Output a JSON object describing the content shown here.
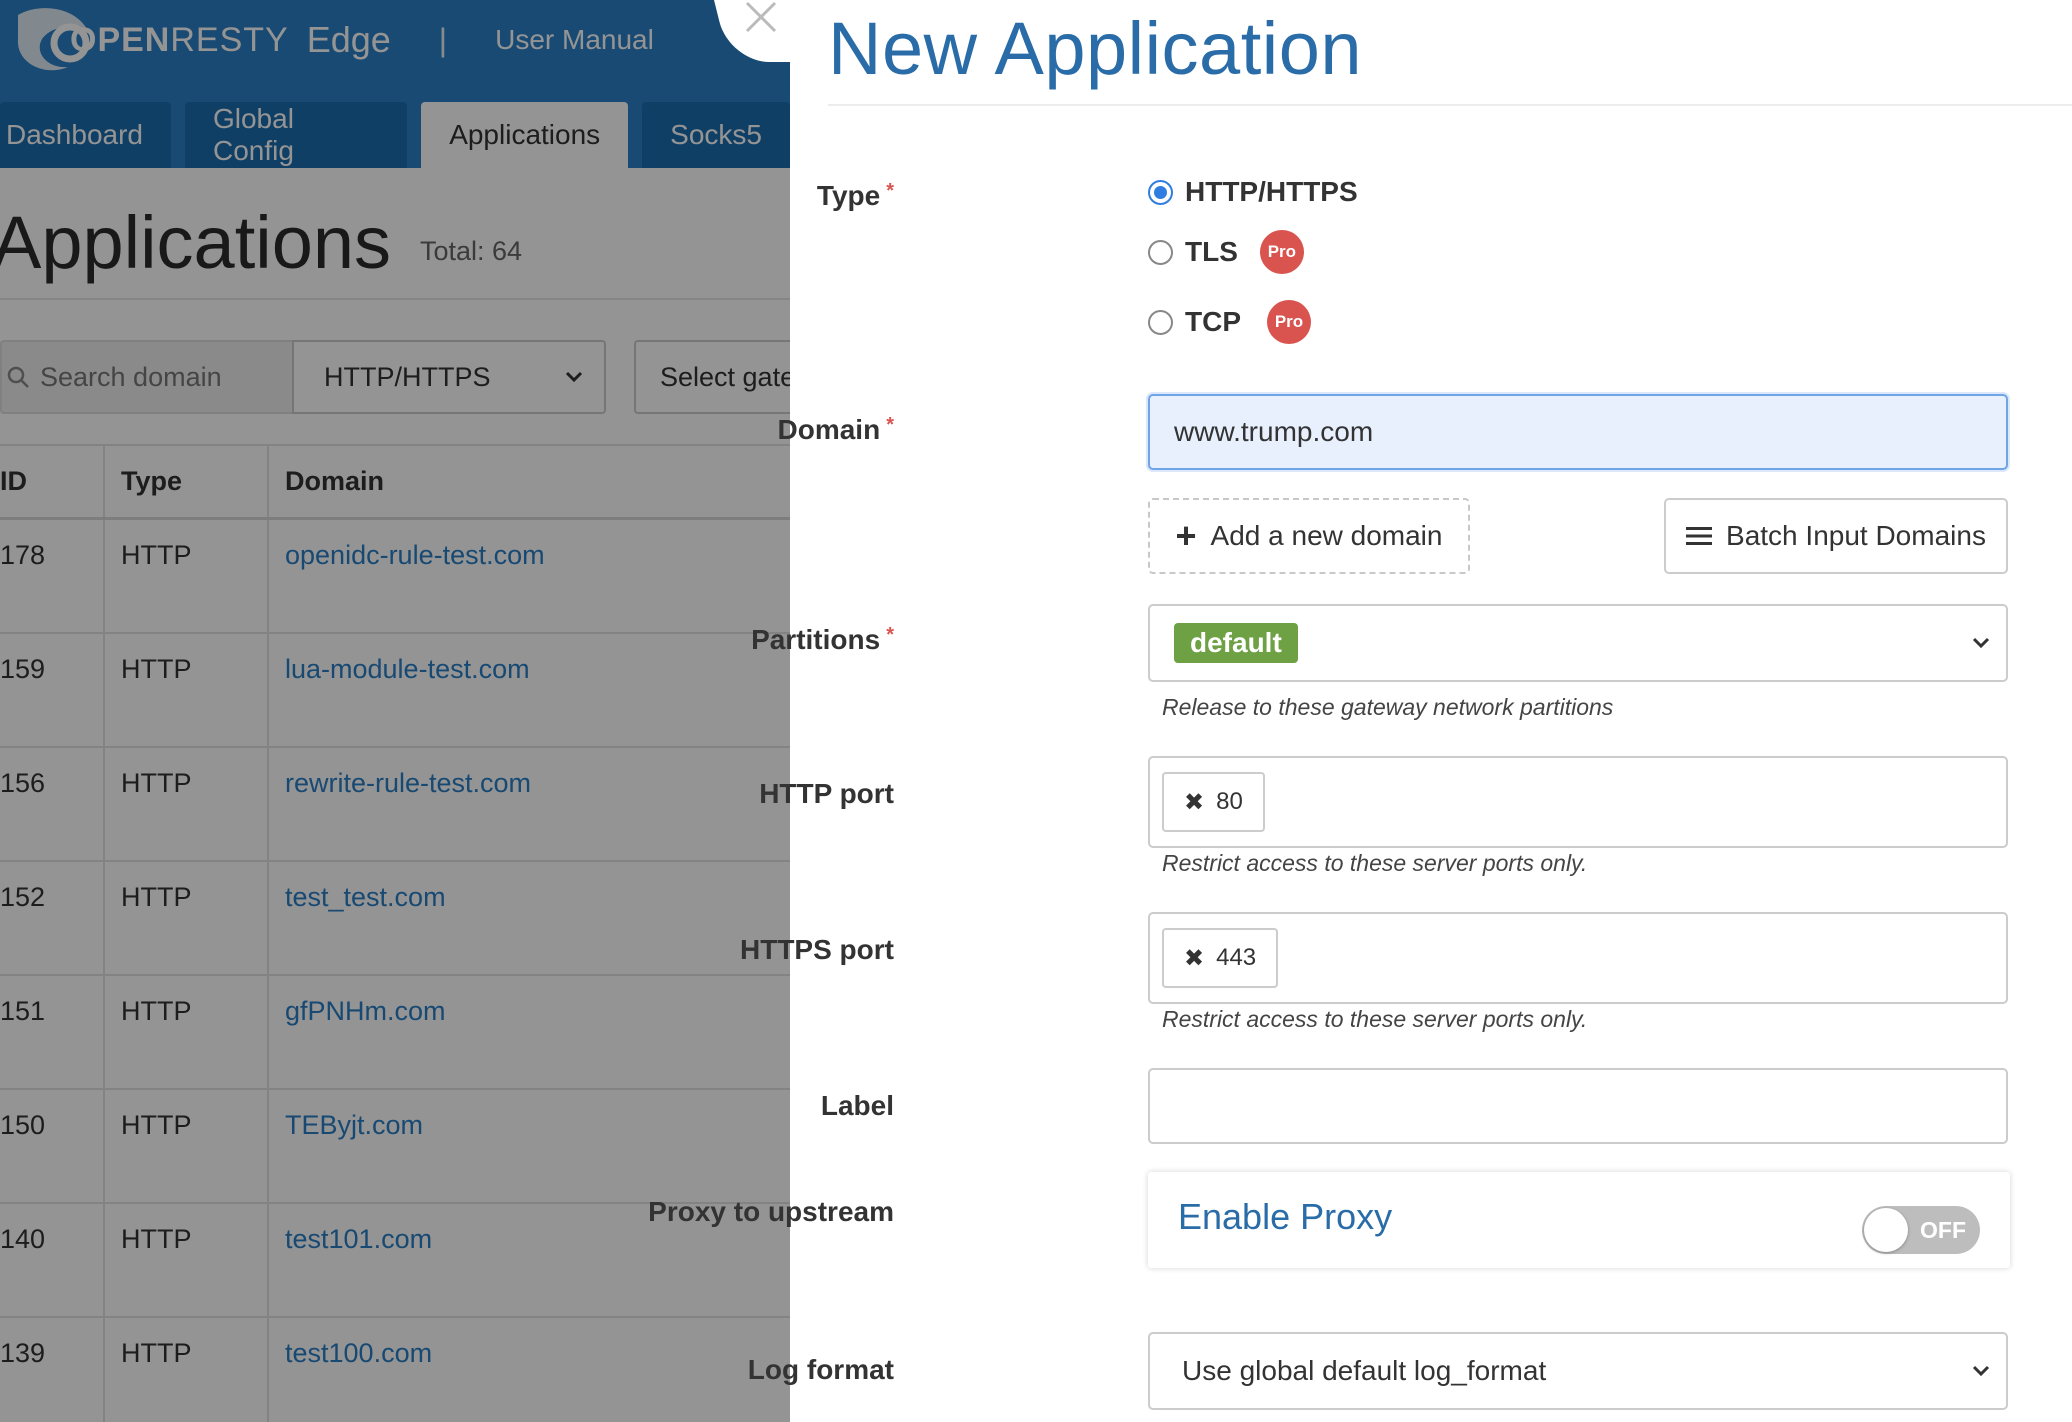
{
  "app": {
    "brand_name_bold": "OPEN",
    "brand_name_light": "RESTY",
    "brand_edge": "Edge",
    "brand_sep": "|",
    "user_manual": "User Manual"
  },
  "nav": {
    "tabs": [
      {
        "label": "Dashboard",
        "active": false
      },
      {
        "label": "Global Config",
        "active": false
      },
      {
        "label": "Applications",
        "active": true
      },
      {
        "label": "Socks5",
        "active": false
      }
    ]
  },
  "list_page": {
    "title": "Applications",
    "total": "Total: 64",
    "search_placeholder": "Search domain",
    "type_filter": "HTTP/HTTPS",
    "gateway_filter": "Select gateway",
    "columns": [
      "ID",
      "Type",
      "Domain"
    ],
    "rows": [
      {
        "id": "178",
        "type": "HTTP",
        "domain": "openidc-rule-test.com"
      },
      {
        "id": "159",
        "type": "HTTP",
        "domain": "lua-module-test.com"
      },
      {
        "id": "156",
        "type": "HTTP",
        "domain": "rewrite-rule-test.com"
      },
      {
        "id": "152",
        "type": "HTTP",
        "domain": "test_test.com"
      },
      {
        "id": "151",
        "type": "HTTP",
        "domain": "gfPNHm.com"
      },
      {
        "id": "150",
        "type": "HTTP",
        "domain": "TEByjt.com"
      },
      {
        "id": "140",
        "type": "HTTP",
        "domain": "test101.com"
      },
      {
        "id": "139",
        "type": "HTTP",
        "domain": "test100.com"
      }
    ]
  },
  "drawer": {
    "title": "New Application",
    "type_label": "Type",
    "type_options": [
      {
        "label": "HTTP/HTTPS",
        "selected": true,
        "pro": false
      },
      {
        "label": "TLS",
        "selected": false,
        "pro": true
      },
      {
        "label": "TCP",
        "selected": false,
        "pro": true
      }
    ],
    "pro_badge": "Pro",
    "domain_label": "Domain",
    "domain_value": "www.trump.com",
    "add_domain_button": "Add a new domain",
    "batch_input_button": "Batch Input Domains",
    "partitions_label": "Partitions",
    "partition_tag": "default",
    "partitions_help": "Release to these gateway network partitions",
    "http_port_label": "HTTP port",
    "http_port_value": "80",
    "http_port_help": "Restrict access to these server ports only.",
    "https_port_label": "HTTPS port",
    "https_port_value": "443",
    "https_port_help": "Restrict access to these server ports only.",
    "label_label": "Label",
    "label_value": "",
    "proxy_label": "Proxy to upstream",
    "proxy_text": "Enable Proxy",
    "proxy_toggle": "OFF",
    "log_format_label": "Log format",
    "log_format_value": "Use global default log_format"
  },
  "colors": {
    "topbar": "#2a80c6",
    "accent": "#2a6ca8",
    "required": "#d9534f",
    "partition_tag": "#6ea044"
  }
}
